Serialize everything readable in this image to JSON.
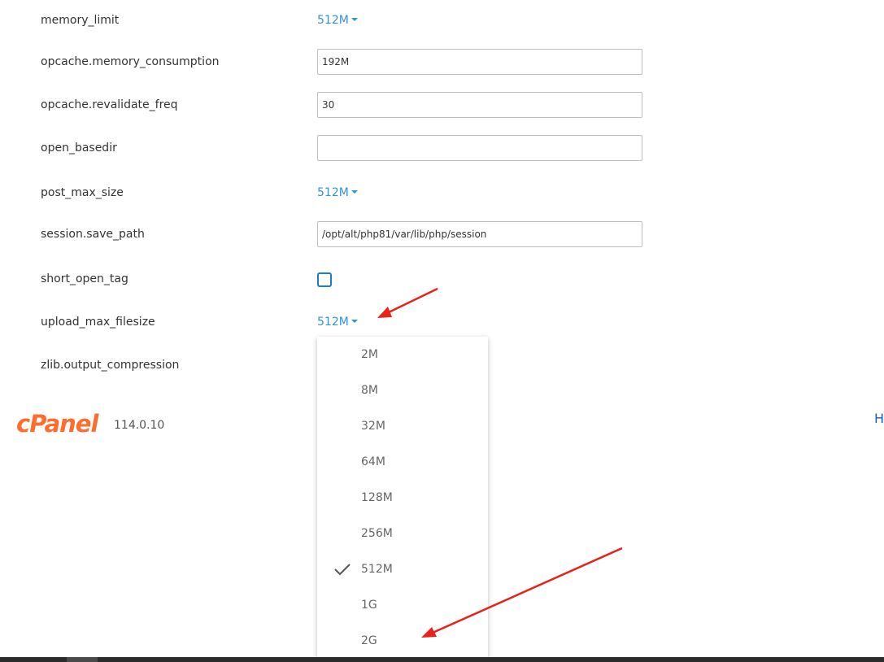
{
  "settings": [
    {
      "label": "memory_limit",
      "type": "dropdown",
      "value": "512M"
    },
    {
      "label": "opcache.memory_consumption",
      "type": "text",
      "value": "192M"
    },
    {
      "label": "opcache.revalidate_freq",
      "type": "text",
      "value": "30"
    },
    {
      "label": "open_basedir",
      "type": "text",
      "value": ""
    },
    {
      "label": "post_max_size",
      "type": "dropdown",
      "value": "512M"
    },
    {
      "label": "session.save_path",
      "type": "text",
      "value": "/opt/alt/php81/var/lib/php/session"
    },
    {
      "label": "short_open_tag",
      "type": "checkbox",
      "checked": false
    },
    {
      "label": "upload_max_filesize",
      "type": "dropdown",
      "value": "512M"
    },
    {
      "label": "zlib.output_compression",
      "type": "checkbox",
      "checked": false
    }
  ],
  "upload_dropdown": {
    "options": [
      "2M",
      "8M",
      "32M",
      "64M",
      "128M",
      "256M",
      "512M",
      "1G",
      "2G"
    ],
    "selected": "512M"
  },
  "footer": {
    "logo_text": "cPanel",
    "version": "114.0.10",
    "right_link": "H"
  },
  "colors": {
    "link_blue": "#2f93e0",
    "checkbox_blue": "#1a7bd1",
    "cpanel_orange": "#ff6c2c",
    "arrow_red": "#e8221b"
  },
  "icons": {
    "caret": "caret-down-icon",
    "check": "checkmark-icon",
    "arrow": "red-arrow-annotation"
  }
}
